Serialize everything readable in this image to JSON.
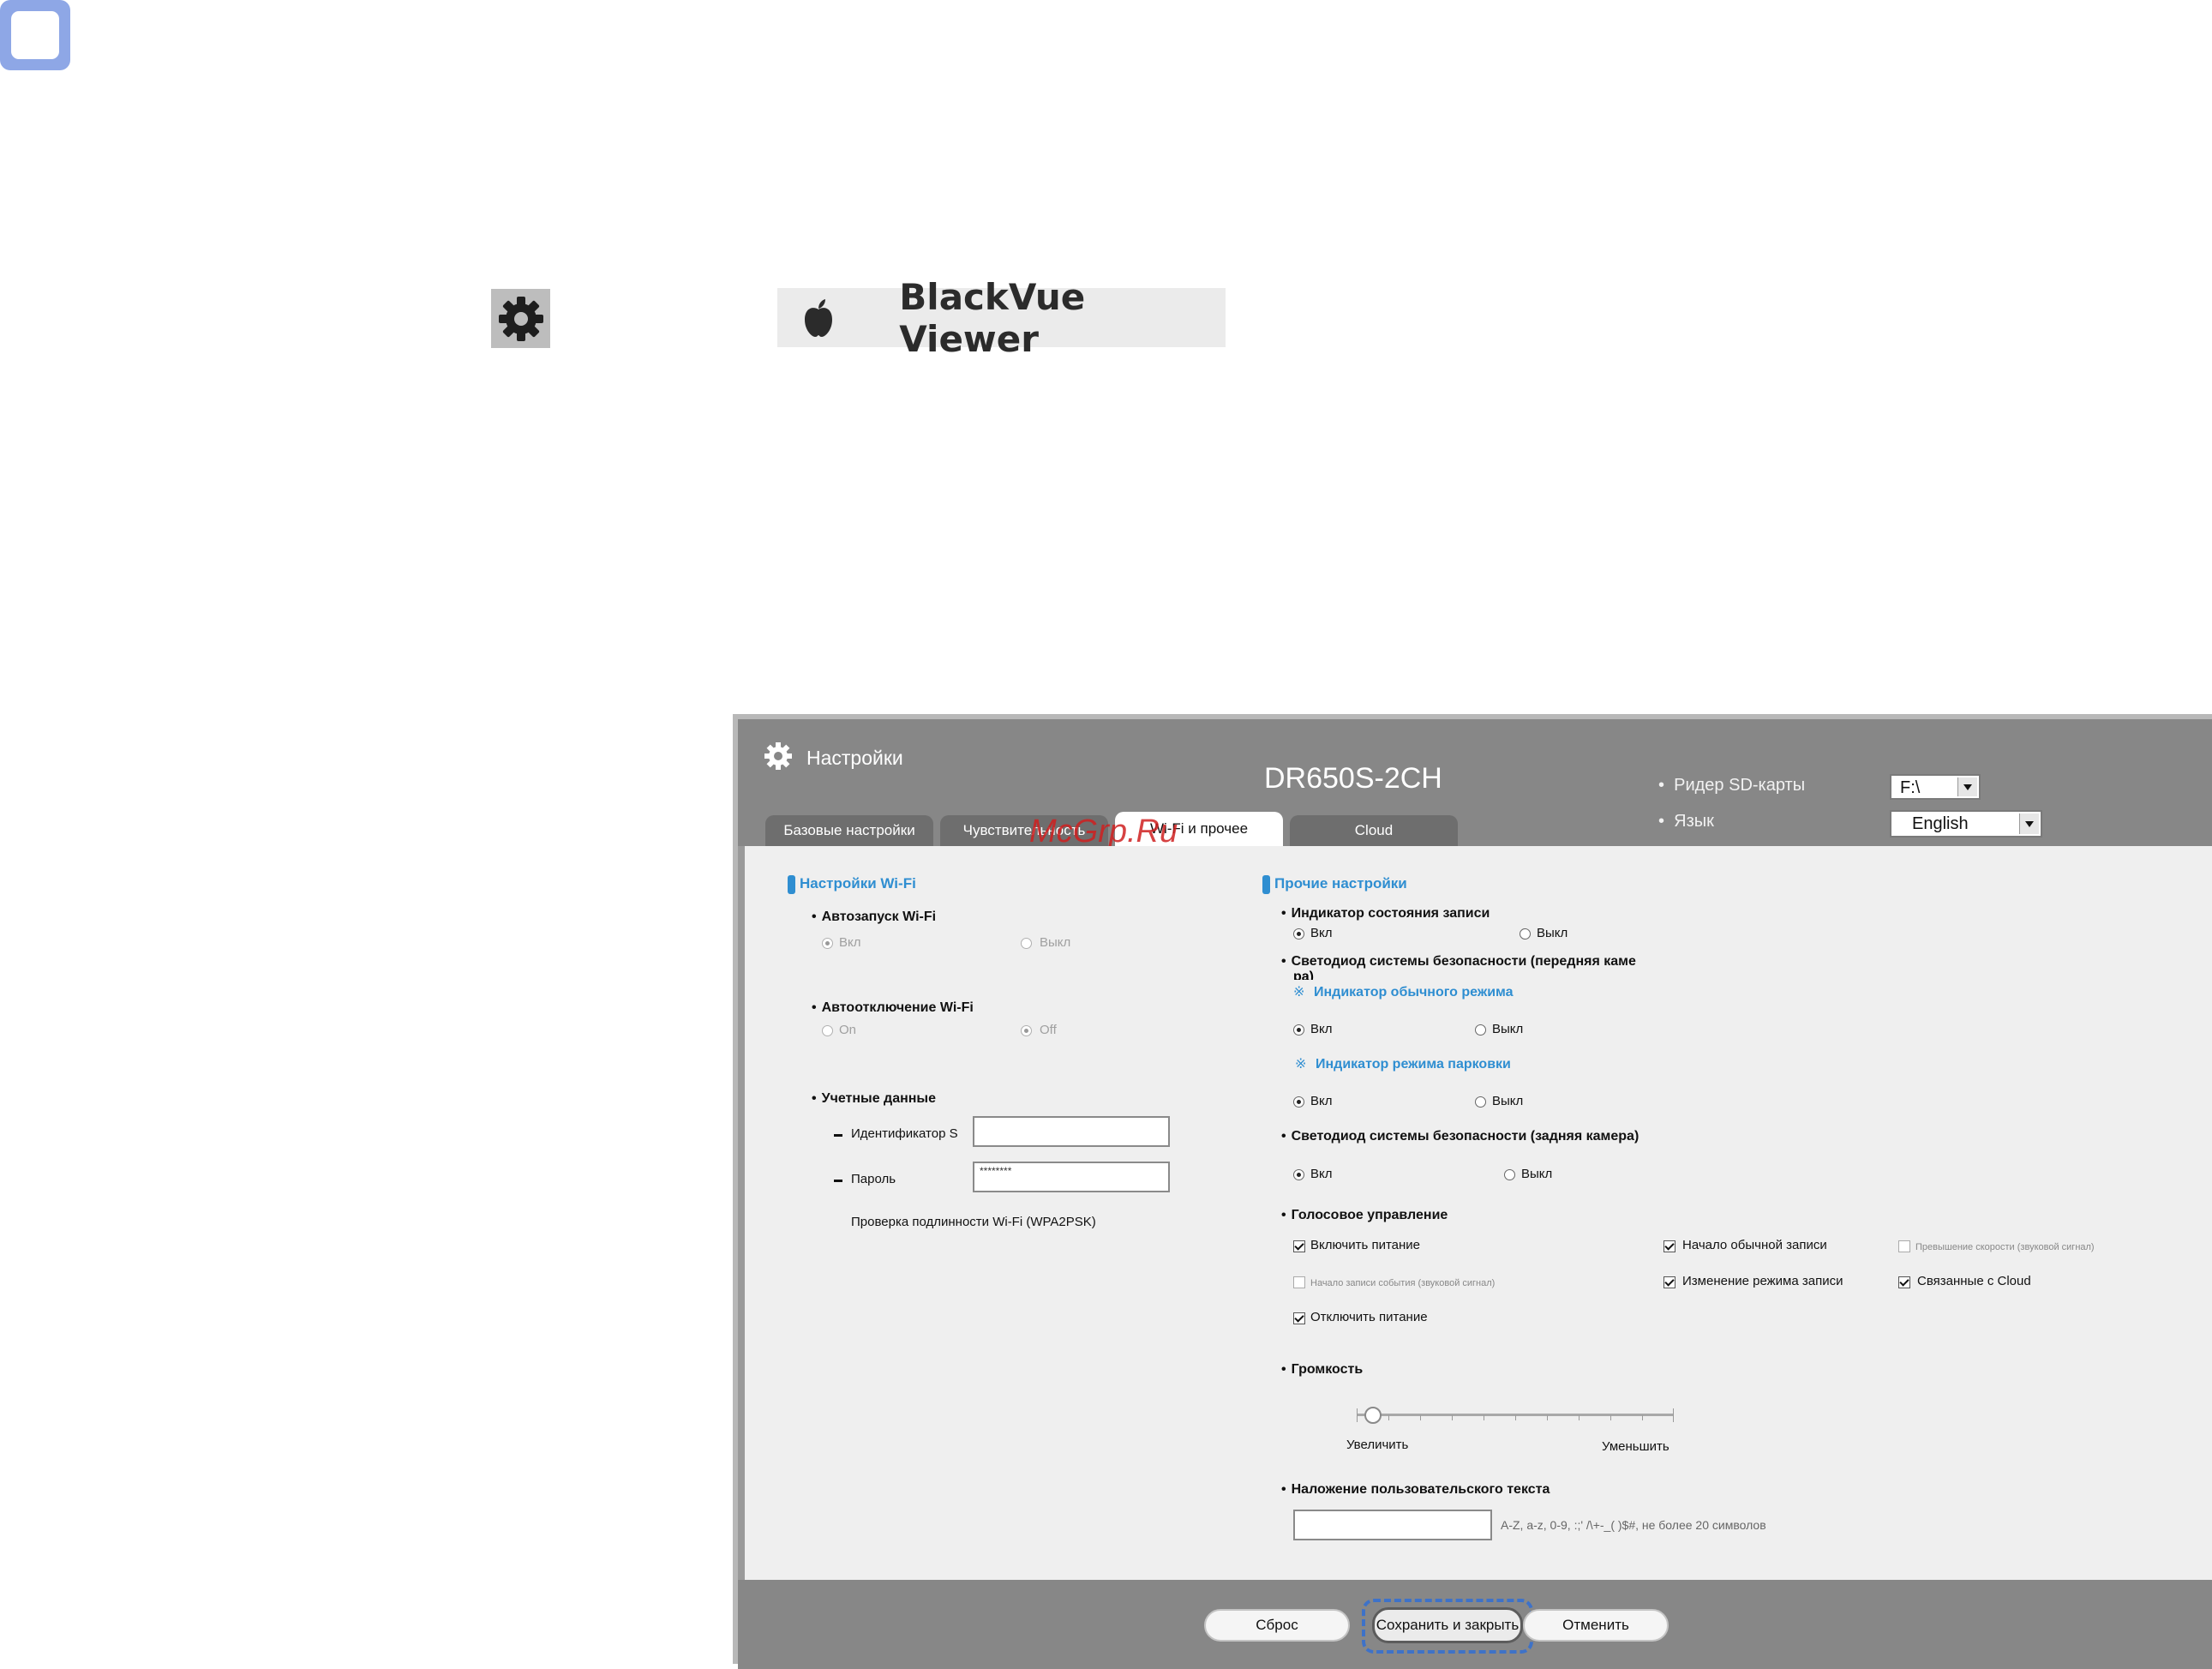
{
  "top_label": {
    "app_name": "BlackVue Viewer",
    "icons": [
      "gear-icon",
      "apple-icon"
    ]
  },
  "watermark": "McGrp.Ru",
  "window": {
    "title": "Настройки",
    "model": "DR650S-2CH",
    "sd_reader": {
      "label": "Ридер SD-карты",
      "value": "F:\\"
    },
    "language": {
      "label": "Язык",
      "value": "English"
    },
    "tabs": [
      "Базовые настройки",
      "Чувствительность",
      "Wi-Fi и прочее",
      "Cloud"
    ],
    "active_tab": "Wi-Fi и прочее"
  },
  "wifi": {
    "section": "Настройки Wi-Fi",
    "autostart": {
      "label": "Автозапуск Wi-Fi",
      "options": [
        "Вкл",
        "Выкл"
      ],
      "selected": "Вкл"
    },
    "autooff": {
      "label": "Автоотключение Wi-Fi",
      "options": [
        "On",
        "Off"
      ],
      "selected": "Off"
    },
    "credentials": {
      "label": "Учетные данные",
      "ssid_label": "Идентификатор S",
      "ssid_value": "",
      "password_label": "Пароль",
      "password_value": "********",
      "auth_note": "Проверка подлинности Wi-Fi (WPA2PSK)"
    }
  },
  "other": {
    "section": "Прочие настройки",
    "rec_indicator": {
      "label": "Индикатор состояния записи",
      "options": [
        "Вкл",
        "Выкл"
      ],
      "selected": "Вкл"
    },
    "front_led": {
      "label_line1": "Светодиод системы безопасности (передняя каме",
      "label_line2": "ра)",
      "normal": {
        "label": "Индикатор обычного режима",
        "options": [
          "Вкл",
          "Выкл"
        ],
        "selected": "Вкл"
      },
      "parking": {
        "label": "Индикатор режима парковки",
        "options": [
          "Вкл",
          "Выкл"
        ],
        "selected": "Вкл"
      }
    },
    "rear_led": {
      "label": "Светодиод системы безопасности (задняя камера)",
      "options": [
        "Вкл",
        "Выкл"
      ],
      "selected": "Вкл"
    },
    "voice": {
      "label": "Голосовое управление",
      "items": [
        {
          "label": "Включить питание",
          "checked": true
        },
        {
          "label": "Начало обычной записи",
          "checked": true
        },
        {
          "label": "Превышение скорости (звуковой сигнал)",
          "checked": false,
          "small": true
        },
        {
          "label": "Начало записи события (звуковой сигнал)",
          "checked": false,
          "small": true
        },
        {
          "label": "Изменение режима записи",
          "checked": true
        },
        {
          "label": "Связанные с Cloud",
          "checked": true
        },
        {
          "label": "Отключить питание",
          "checked": true
        }
      ]
    },
    "volume": {
      "label": "Громкость",
      "increase": "Увеличить",
      "decrease": "Уменьшить",
      "level": 0.05
    },
    "overlay": {
      "label": "Наложение пользовательского текста",
      "value": "",
      "hint": "A-Z, a-z, 0-9, :;' /\\+-_( )$#, не более 20 символов"
    }
  },
  "footer": {
    "reset": "Сброс",
    "save": "Сохранить и закрыть",
    "cancel": "Отменить"
  }
}
